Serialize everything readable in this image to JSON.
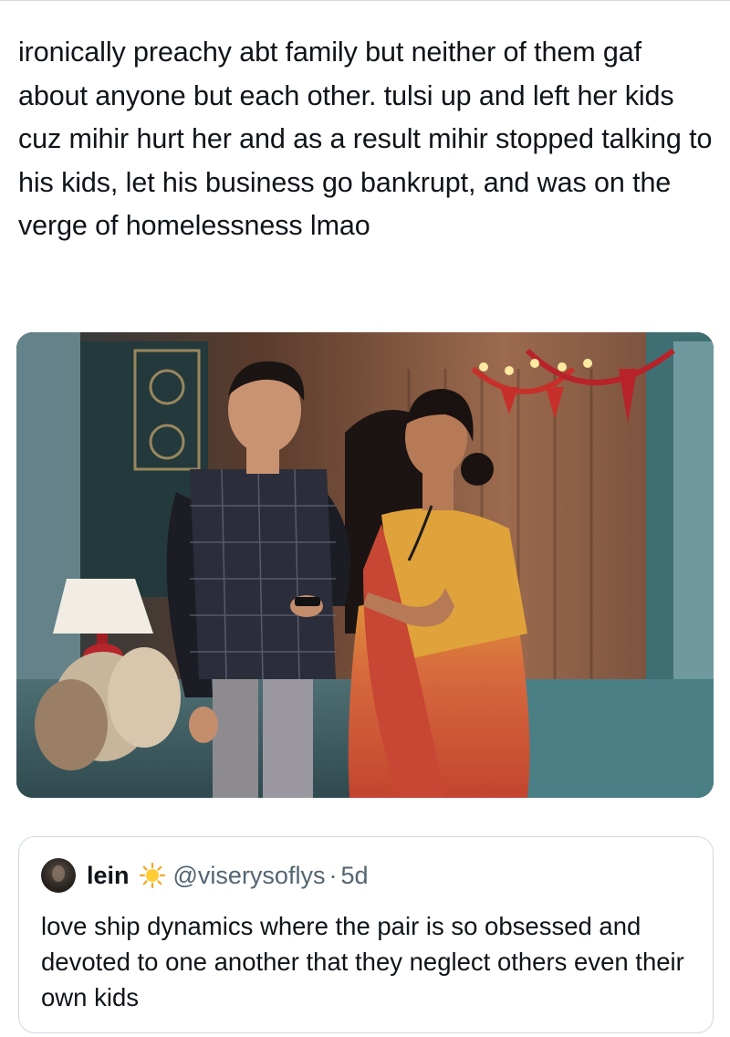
{
  "tweet": {
    "text": "ironically preachy abt family but neither of them gaf about anyone but each other. tulsi up and left her kids cuz mihir hurt her and as a result mihir stopped talking to his kids, let his business go bankrupt, and was on the verge of homelessness lmao"
  },
  "media": {
    "icon": "tv-drama-still-image"
  },
  "quote": {
    "display_name": "lein",
    "emoji_icon": "sun-icon",
    "handle": "@viserysoflys",
    "separator": "·",
    "time": "5d",
    "text": "love ship dynamics where the pair is so obsessed and devoted to one another that they neglect others even their own kids"
  },
  "colors": {
    "text": "#0f1419",
    "secondary": "#536471",
    "border": "#cfd9de"
  }
}
